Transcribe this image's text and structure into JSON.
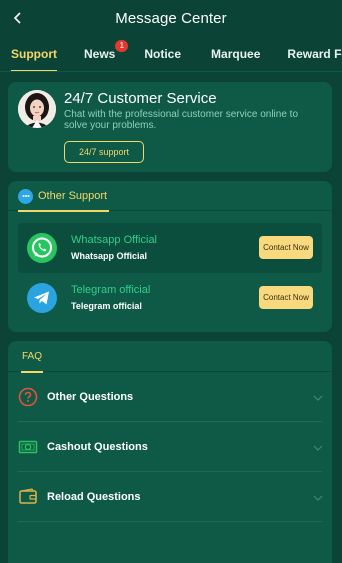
{
  "header": {
    "title": "Message Center"
  },
  "tabs": [
    {
      "label": "Support"
    },
    {
      "label": "News",
      "badge": "1"
    },
    {
      "label": "Notice"
    },
    {
      "label": "Marquee"
    },
    {
      "label": "Reward Feedback"
    }
  ],
  "customer_service": {
    "title": "24/7 Customer Service",
    "description": "Chat with the professional customer service online to solve your problems.",
    "button": "24/7 support"
  },
  "other_support": {
    "tab": "Other Support",
    "items": [
      {
        "name": "Whatsapp Official",
        "sub": "Whatsapp Official",
        "action": "Contact Now",
        "icon": "whatsapp-icon"
      },
      {
        "name": "Telegram official",
        "sub": "Telegram official",
        "action": "Contact Now",
        "icon": "telegram-icon"
      }
    ]
  },
  "faq": {
    "tab": "FAQ",
    "items": [
      {
        "label": "Other Questions",
        "icon": "question-icon"
      },
      {
        "label": "Cashout Questions",
        "icon": "cash-icon"
      },
      {
        "label": "Reload Questions",
        "icon": "wallet-icon"
      }
    ]
  },
  "colors": {
    "background": "#0b4436",
    "card": "#0e5a47",
    "accent": "#f4d86a",
    "button": "#f9d97e",
    "green_text": "#2fcf8a",
    "badge": "#e0392f"
  }
}
